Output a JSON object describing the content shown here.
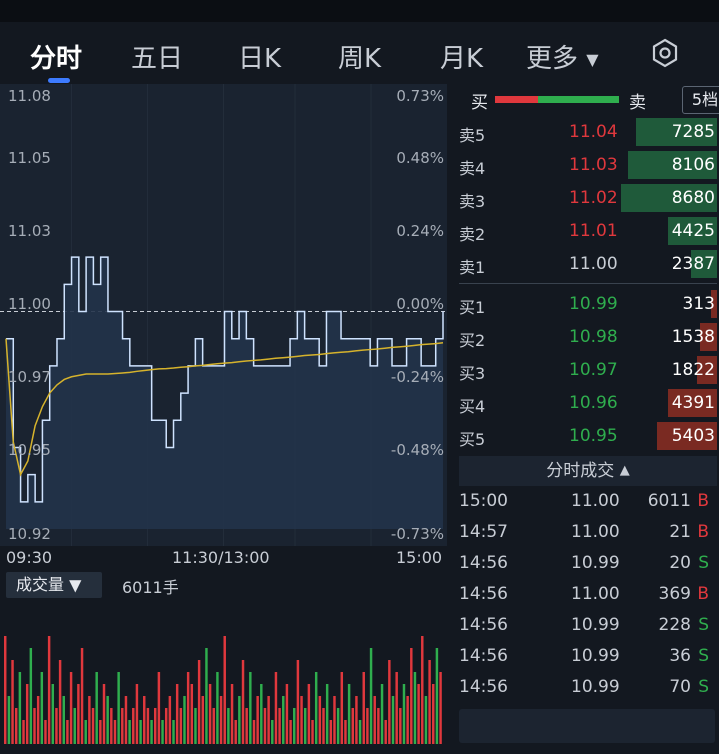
{
  "colors": {
    "up": "#e0383d",
    "down": "#2fae4e",
    "accent": "#3d7bff",
    "vwap": "#d6b32c",
    "price_line": "#cfe3ff"
  },
  "tabs": [
    {
      "label": "分时",
      "active": true
    },
    {
      "label": "五日"
    },
    {
      "label": "日K"
    },
    {
      "label": "周K"
    },
    {
      "label": "月K"
    },
    {
      "label": "更多"
    }
  ],
  "settings_icon": "gear-icon",
  "chart": {
    "price_axis": [
      "11.08",
      "11.05",
      "11.03",
      "11.00",
      "10.97",
      "10.95",
      "10.92"
    ],
    "pct_axis": [
      "0.73%",
      "0.48%",
      "0.24%",
      "0.00%",
      "-0.24%",
      "-0.48%",
      "-0.73%"
    ],
    "time_axis": [
      "09:30",
      "11:30/13:00",
      "15:00"
    ],
    "volume_label": "成交量",
    "volume_value": "6011手"
  },
  "chart_data": {
    "type": "line",
    "y_range": [
      10.92,
      11.08
    ],
    "prev_close": 11.0,
    "price": [
      10.99,
      10.95,
      10.93,
      10.94,
      10.93,
      10.96,
      10.98,
      10.99,
      11.01,
      11.02,
      11.0,
      11.02,
      11.01,
      11.02,
      11.0,
      11.0,
      10.99,
      10.98,
      10.98,
      10.98,
      10.96,
      10.96,
      10.95,
      10.96,
      10.97,
      10.98,
      10.99,
      10.98,
      10.98,
      10.98,
      11.0,
      10.99,
      11.0,
      10.99,
      10.98,
      10.98,
      10.98,
      10.98,
      10.98,
      10.99,
      11.0,
      10.99,
      10.99,
      10.98,
      11.0,
      11.0,
      10.99,
      10.99,
      10.99,
      10.99,
      10.98,
      10.99,
      10.99,
      10.98,
      10.98,
      10.99,
      10.99,
      10.98,
      10.98,
      10.99,
      11.0
    ],
    "avg": [
      10.99,
      10.952,
      10.94,
      10.945,
      10.958,
      10.965,
      10.97,
      10.973,
      10.975,
      10.976,
      10.9765,
      10.977,
      10.977,
      10.977,
      10.977,
      10.9772,
      10.9774,
      10.9776,
      10.978,
      10.9783,
      10.9786,
      10.9789,
      10.979,
      10.9792,
      10.9795,
      10.9797,
      10.98,
      10.9802,
      10.9805,
      10.9808,
      10.981,
      10.9812,
      10.9815,
      10.9818,
      10.982,
      10.9822,
      10.9825,
      10.9828,
      10.983,
      10.9832,
      10.9835,
      10.9838,
      10.984,
      10.9842,
      10.9845,
      10.9848,
      10.985,
      10.9852,
      10.9855,
      10.9858,
      10.986,
      10.9862,
      10.9865,
      10.9868,
      10.987,
      10.9872,
      10.9875,
      10.9878,
      10.988,
      10.9882,
      10.9885
    ],
    "volume": [
      9,
      4,
      7,
      3,
      6,
      2,
      5,
      8,
      3,
      4,
      6,
      2,
      9,
      5,
      3,
      7,
      4,
      2,
      6,
      3,
      5,
      8,
      2,
      4,
      3,
      6,
      2,
      5,
      4,
      3,
      2,
      6,
      3,
      4,
      2,
      3,
      5,
      2,
      4,
      3,
      2,
      3,
      6,
      2,
      3,
      4,
      2,
      5,
      3,
      4,
      6,
      5,
      3,
      7,
      4,
      8,
      5,
      3,
      6,
      4,
      9,
      3,
      5,
      2,
      4,
      7,
      3,
      6,
      2,
      4,
      5,
      3,
      4,
      2,
      6,
      3,
      4,
      5,
      2,
      3,
      7,
      4,
      3,
      5,
      2,
      6,
      4,
      3,
      5,
      2,
      4,
      3,
      6,
      2,
      5,
      3,
      4,
      2,
      6,
      3,
      8,
      4,
      3,
      5,
      2,
      7,
      4,
      6,
      3,
      5,
      4,
      8,
      6,
      5,
      9,
      4,
      7,
      5,
      8,
      6
    ]
  },
  "orderbook": {
    "buy_label": "买",
    "sell_label": "卖",
    "buy_ratio": 0.35,
    "level_button": "5档",
    "asks": [
      {
        "label": "卖5",
        "price": "11.04",
        "volume": "7285",
        "ratio": 0.84
      },
      {
        "label": "卖4",
        "price": "11.03",
        "volume": "8106",
        "ratio": 0.93
      },
      {
        "label": "卖3",
        "price": "11.02",
        "volume": "8680",
        "ratio": 1.0
      },
      {
        "label": "卖2",
        "price": "11.01",
        "volume": "4425",
        "ratio": 0.51
      },
      {
        "label": "卖1",
        "price": "11.00",
        "volume": "2387",
        "ratio": 0.27
      }
    ],
    "bids": [
      {
        "label": "买1",
        "price": "10.99",
        "volume": "313",
        "ratio": 0.04
      },
      {
        "label": "买2",
        "price": "10.98",
        "volume": "1538",
        "ratio": 0.18
      },
      {
        "label": "买3",
        "price": "10.97",
        "volume": "1822",
        "ratio": 0.21
      },
      {
        "label": "买4",
        "price": "10.96",
        "volume": "4391",
        "ratio": 0.51
      },
      {
        "label": "买5",
        "price": "10.95",
        "volume": "5403",
        "ratio": 0.62
      }
    ]
  },
  "trades": {
    "header": "分时成交",
    "rows": [
      {
        "time": "15:00",
        "price": "11.00",
        "volume": "6011",
        "side": "B"
      },
      {
        "time": "14:57",
        "price": "11.00",
        "volume": "21",
        "side": "B"
      },
      {
        "time": "14:56",
        "price": "10.99",
        "volume": "20",
        "side": "S"
      },
      {
        "time": "14:56",
        "price": "11.00",
        "volume": "369",
        "side": "B"
      },
      {
        "time": "14:56",
        "price": "10.99",
        "volume": "228",
        "side": "S"
      },
      {
        "time": "14:56",
        "price": "10.99",
        "volume": "36",
        "side": "S"
      },
      {
        "time": "14:56",
        "price": "10.99",
        "volume": "70",
        "side": "S"
      }
    ]
  }
}
